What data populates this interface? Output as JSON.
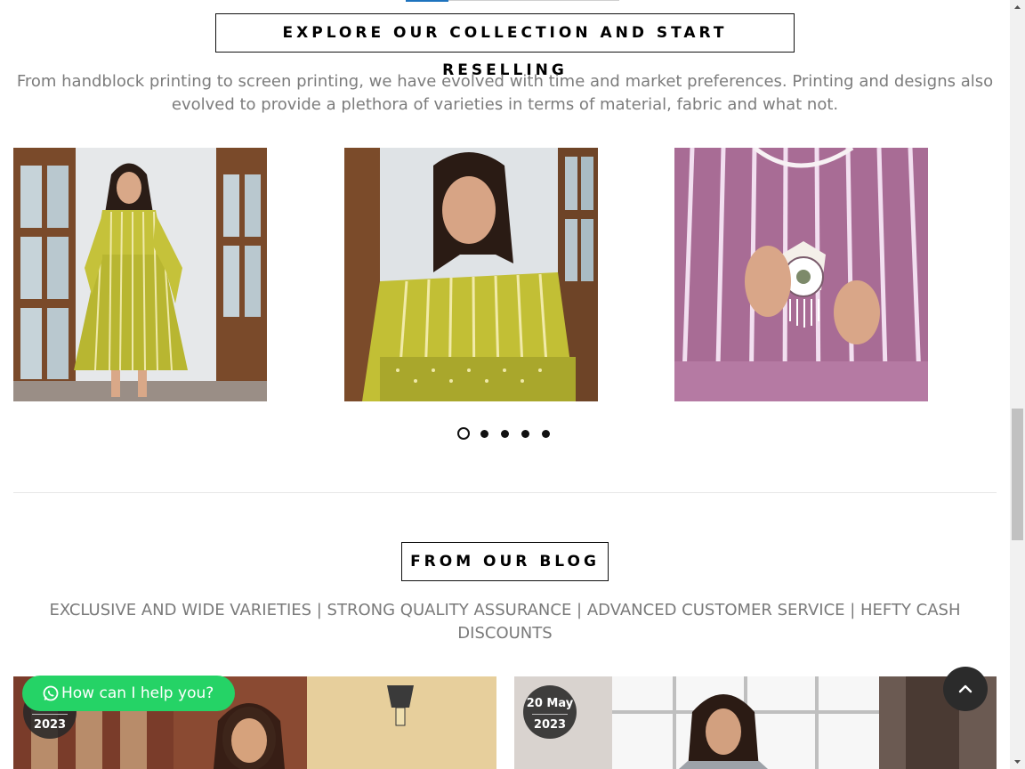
{
  "collection": {
    "title": "EXPLORE OUR COLLECTION AND START RESELLING",
    "description": "From handblock printing to screen printing, we have evolved with time and market preferences. Printing and designs also evolved to provide a plethora of varieties in terms of material, fabric and what not.",
    "slides": [
      {
        "subject": "yellow-striped-dress-full-length"
      },
      {
        "subject": "yellow-striped-top-close-up"
      },
      {
        "subject": "pink-striped-top-with-necklace"
      }
    ],
    "carousel": {
      "total_pages": 5,
      "active_page": 1
    }
  },
  "blog": {
    "title": "FROM OUR BLOG",
    "subtitle": "EXCLUSIVE AND WIDE VARIETIES | STRONG QUALITY ASSURANCE | ADVANCED CUSTOMER SERVICE | HEFTY CASH DISCOUNTS",
    "posts": [
      {
        "date_line1": "",
        "date_line2": "2023"
      },
      {
        "date_line1": "20 May",
        "date_line2": "2023"
      }
    ]
  },
  "whatsapp": {
    "label": "How can I help you?",
    "icon": "whatsapp-icon",
    "color": "#25d366"
  },
  "back_to_top": {
    "icon": "chevron-up-icon"
  },
  "colors": {
    "accent": "#1e73be",
    "text_muted": "#7c7c7c",
    "border": "#111111"
  }
}
